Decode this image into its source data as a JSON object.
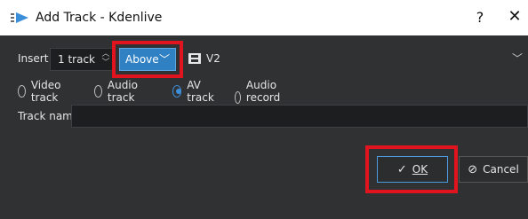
{
  "window": {
    "title": "Add Track - Kdenlive",
    "help_label": "?",
    "close_label": "✕"
  },
  "insert": {
    "label": "Insert",
    "count_value": "1 track",
    "position_value": "Above",
    "track_value": "V2"
  },
  "track_type": {
    "options": [
      {
        "label": "Video track",
        "checked": false
      },
      {
        "label": "Audio track",
        "checked": false
      },
      {
        "label": "AV track",
        "checked": true
      },
      {
        "label": "Audio record track",
        "checked": false
      }
    ]
  },
  "track_name": {
    "label": "Track name",
    "value": ""
  },
  "buttons": {
    "ok_label": "OK",
    "cancel_label": "Cancel"
  },
  "colors": {
    "highlight": "#e0141e",
    "accent": "#2f81c4"
  }
}
